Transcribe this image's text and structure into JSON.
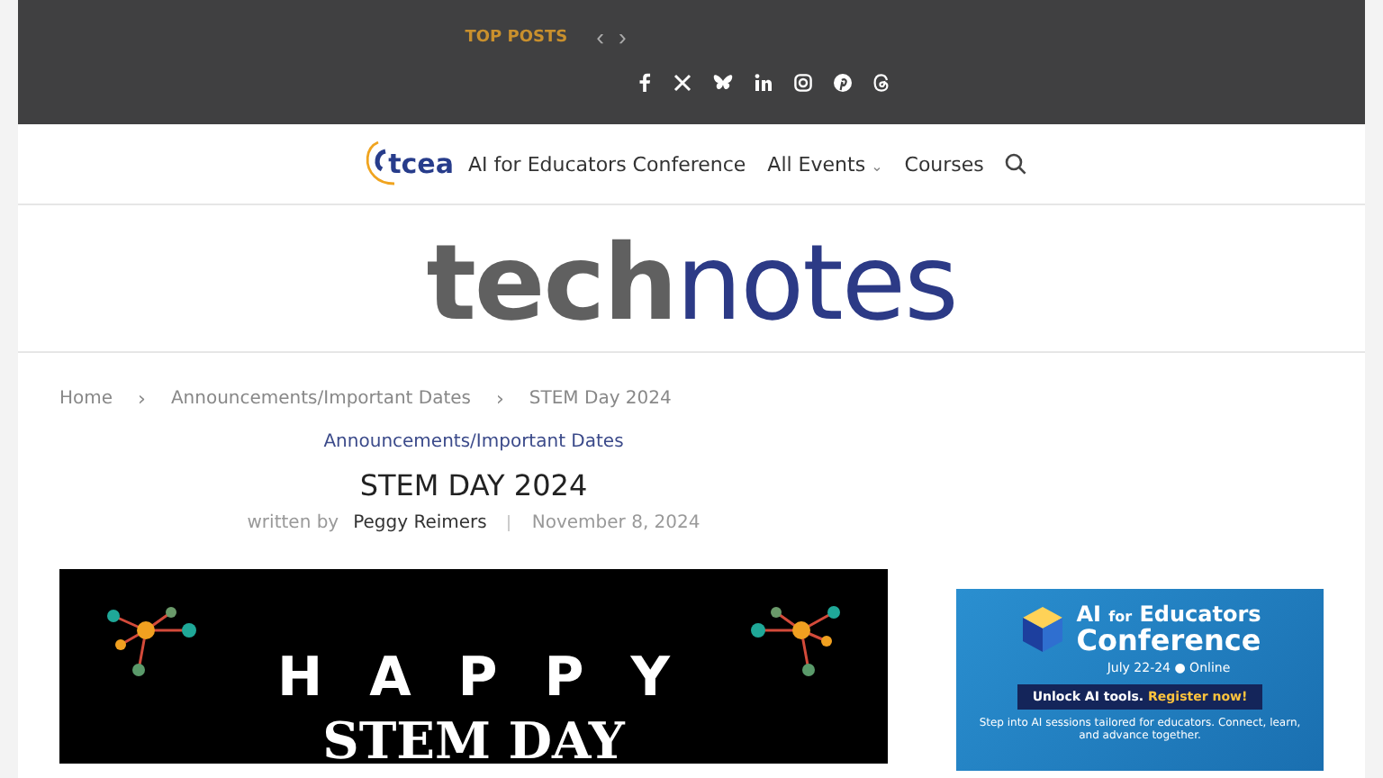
{
  "top_bar": {
    "label": "TOP POSTS",
    "prev": "‹",
    "next": "›",
    "social": [
      {
        "kind": "facebook"
      },
      {
        "kind": "x"
      },
      {
        "kind": "bluesky"
      },
      {
        "kind": "linkedin"
      },
      {
        "kind": "instagram"
      },
      {
        "kind": "pinterest"
      },
      {
        "kind": "threads"
      }
    ]
  },
  "nav": {
    "logo": "tcea",
    "items": [
      {
        "label": "AI for Educators Conference"
      },
      {
        "label": "All Events",
        "caret": "⌄"
      },
      {
        "label": "Courses"
      }
    ]
  },
  "site_title": {
    "part1": "tech",
    "part2": "notes"
  },
  "breadcrumb": {
    "separator": "›",
    "items": [
      "Home",
      "Announcements/Important Dates",
      "STEM Day 2024"
    ]
  },
  "article": {
    "category": "Announcements/Important Dates",
    "title": "STEM DAY 2024",
    "byline_prefix": "written by",
    "author": "Peggy Reimers",
    "date": "November 8, 2024",
    "banner_line1": "HAPPY",
    "banner_line2": "STEM DAY"
  },
  "ad": {
    "title_ai": "AI",
    "title_for": "for",
    "title_educators": "Educators",
    "title_conference": "Conference",
    "dates": "July 22-24 ● Online",
    "cta_plain": "Unlock AI tools.",
    "cta_highlight": "Register now!",
    "blurb": "Step into AI sessions tailored for educators. Connect, learn, and advance together."
  }
}
